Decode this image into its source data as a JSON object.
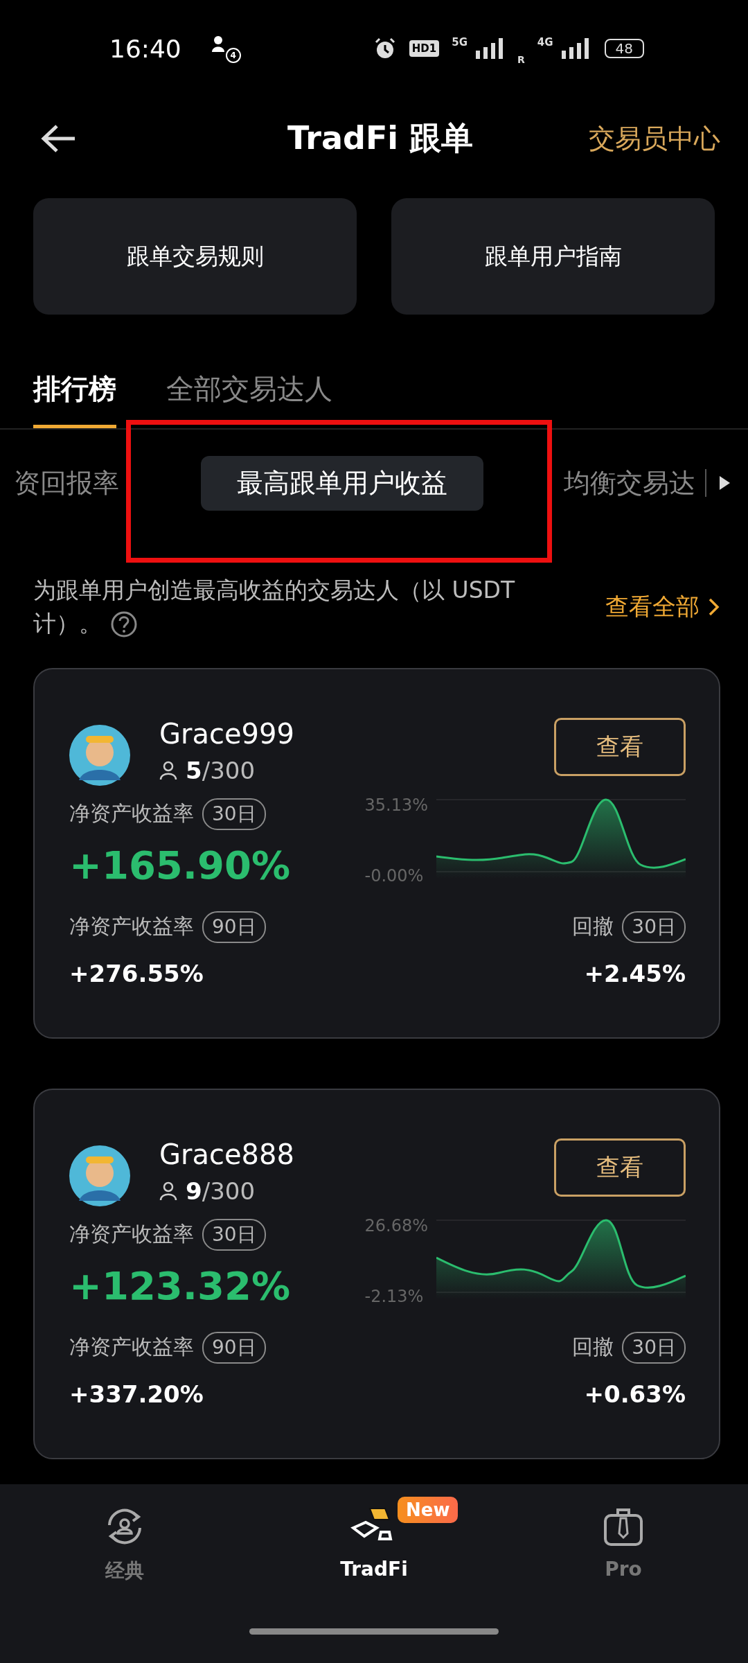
{
  "status_bar": {
    "time": "16:40",
    "notification_count": "4",
    "hd_label": "HD1",
    "network_1": "5G",
    "network_2": "4G",
    "roaming": "R",
    "battery": "48"
  },
  "header": {
    "title": "TradFi 跟单",
    "action": "交易员中心"
  },
  "guide_buttons": [
    "跟单交易规则",
    "跟单用户指南"
  ],
  "tabs": [
    {
      "label": "排行榜",
      "selected": true
    },
    {
      "label": "全部交易达人",
      "selected": false
    }
  ],
  "filters": [
    {
      "label": "资回报率",
      "selected": false
    },
    {
      "label": "最高跟单用户收益",
      "selected": true
    },
    {
      "label": "均衡交易达",
      "selected": false
    }
  ],
  "description_lines": [
    "为跟单用户创造最高收益的交易达人（以 USDT",
    "计）。"
  ],
  "view_all": "查看全部",
  "traders": [
    {
      "name": "Grace999",
      "followers": "5",
      "capacity": "/300",
      "button": "查看",
      "roi_label": "净资产收益率",
      "roi_period": "30日",
      "roi": "+165.90%",
      "chart_max": "35.13%",
      "chart_min": "-0.00%",
      "roi90_label": "净资产收益率",
      "roi90_period": "90日",
      "roi90": "+276.55%",
      "drawdown_label": "回撤",
      "drawdown_period": "30日",
      "drawdown": "+2.45%"
    },
    {
      "name": "Grace888",
      "followers": "9",
      "capacity": "/300",
      "button": "查看",
      "roi_label": "净资产收益率",
      "roi_period": "30日",
      "roi": "+123.32%",
      "chart_max": "26.68%",
      "chart_min": "-2.13%",
      "roi90_label": "净资产收益率",
      "roi90_period": "90日",
      "roi90": "+337.20%",
      "drawdown_label": "回撤",
      "drawdown_period": "30日",
      "drawdown": "+0.63%"
    }
  ],
  "bottom_nav": [
    {
      "kind": "classic",
      "label": "经典",
      "selected": false
    },
    {
      "kind": "tradfi",
      "label": "TradFi",
      "selected": true,
      "badge": "New"
    },
    {
      "kind": "pro",
      "label": "Pro",
      "selected": false
    }
  ]
}
